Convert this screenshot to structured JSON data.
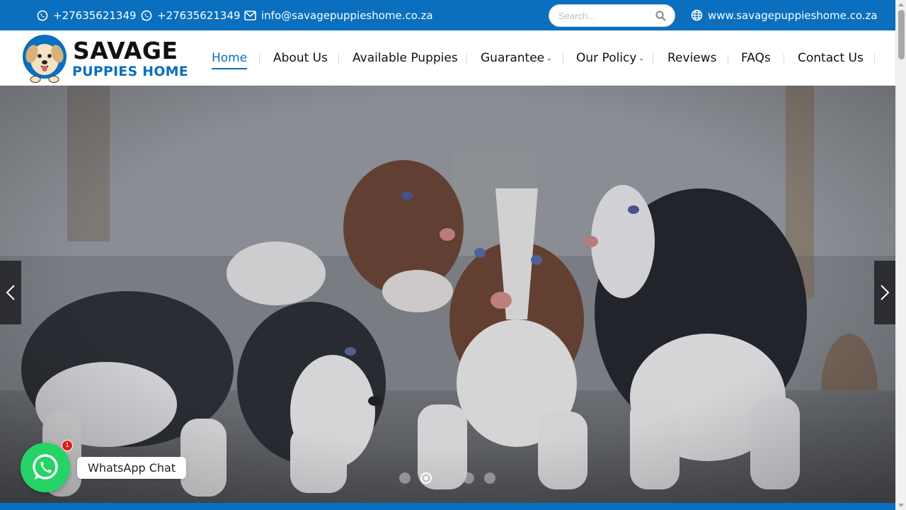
{
  "topbar": {
    "phone1": "+27635621349",
    "phone2": "+27635621349",
    "email": "info@savagepuppieshome.co.za",
    "search_placeholder": "Search...",
    "website": "www.savagepuppieshome.co.za"
  },
  "logo": {
    "line1": "SAVAGE",
    "line2": "PUPPIES HOME"
  },
  "nav": {
    "items": [
      {
        "label": "Home",
        "active": true
      },
      {
        "label": "About Us"
      },
      {
        "label": "Available Puppies"
      },
      {
        "label": "Guarantee",
        "has_dropdown": true
      },
      {
        "label": "Our Policy",
        "has_dropdown": true
      },
      {
        "label": "Reviews"
      },
      {
        "label": "FAQs"
      },
      {
        "label": "Contact Us"
      }
    ]
  },
  "hero": {
    "slide_count": 5,
    "active_slide": 2
  },
  "whatsapp": {
    "label": "WhatsApp Chat",
    "badge": "1"
  },
  "colors": {
    "brand_blue": "#0a6fbe",
    "whatsapp_green": "#25d366",
    "badge_red": "#e01b1b"
  }
}
